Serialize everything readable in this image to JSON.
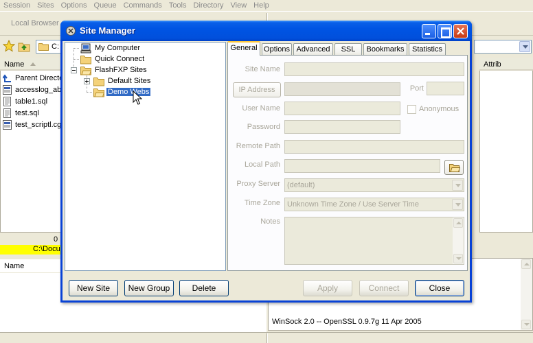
{
  "app": {
    "menu": [
      "Session",
      "Sites",
      "Options",
      "Queue",
      "Commands",
      "Tools",
      "Directory",
      "View",
      "Help"
    ],
    "toolbar_label": "Local Browser",
    "local_path_short": "C:",
    "list_header_name": "Name",
    "right_header_attrib": "Attrib",
    "files": [
      {
        "name": "Parent Directory",
        "icon": "up-arrow-icon"
      },
      {
        "name": "accesslog_ab",
        "icon": "script-file-icon"
      },
      {
        "name": "table1.sql",
        "icon": "text-file-icon"
      },
      {
        "name": "test.sql",
        "icon": "text-file-icon"
      },
      {
        "name": "test_scriptl.cgi",
        "icon": "script-file-icon"
      }
    ],
    "status_count": "0",
    "status_path": "C:\\Docu",
    "queue_header": "Name",
    "log_line": "WinSock 2.0 -- OpenSSL 0.9.7g 11 Apr 2005"
  },
  "dialog": {
    "title": "Site Manager",
    "tree": {
      "my_computer": "My Computer",
      "quick_connect": "Quick Connect",
      "flashfxp_sites": "FlashFXP Sites",
      "default_sites": "Default Sites",
      "demo_webs": "Demo Webs"
    },
    "tabs": [
      "General",
      "Options",
      "Advanced",
      "SSL",
      "Bookmarks",
      "Statistics"
    ],
    "active_tab": "General",
    "form": {
      "site_name_label": "Site Name",
      "ip_address_button": "IP Address",
      "port_label": "Port",
      "user_name_label": "User Name",
      "anonymous_label": "Anonymous",
      "password_label": "Password",
      "remote_path_label": "Remote Path",
      "local_path_label": "Local Path",
      "proxy_server_label": "Proxy Server",
      "proxy_server_value": "(default)",
      "time_zone_label": "Time Zone",
      "time_zone_value": "Unknown Time Zone / Use Server Time",
      "notes_label": "Notes"
    },
    "buttons": {
      "new_site": "New Site",
      "new_group": "New Group",
      "delete": "Delete",
      "apply": "Apply",
      "connect": "Connect",
      "close": "Close"
    }
  }
}
